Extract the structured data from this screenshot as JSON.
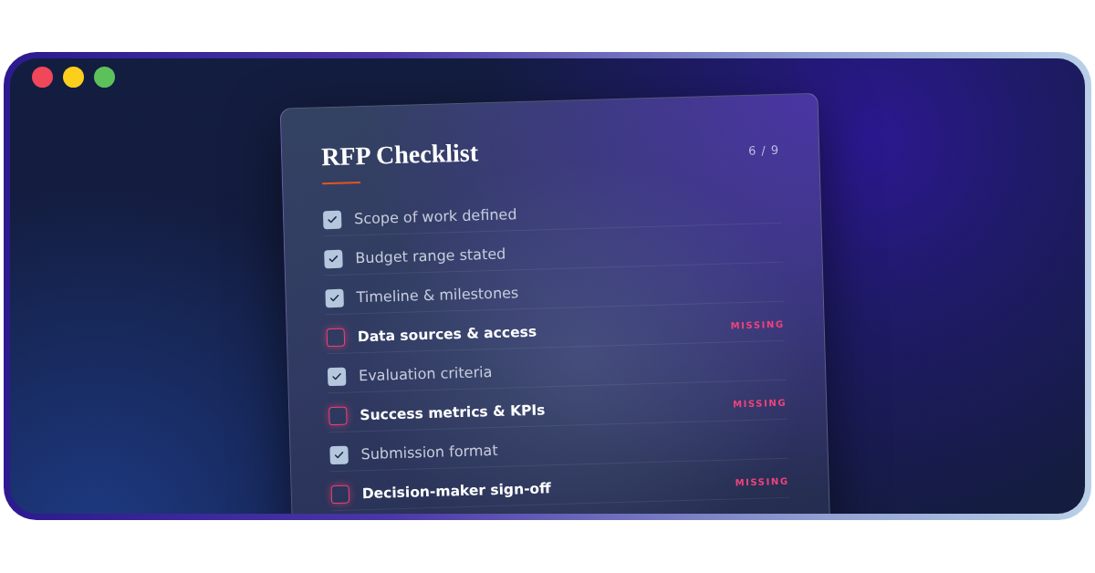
{
  "window": {
    "controls": [
      {
        "color": "#f0475b"
      },
      {
        "color": "#fbcf1c"
      },
      {
        "color": "#5dc15b"
      }
    ]
  },
  "checklist": {
    "title": "RFP Checklist",
    "count": "6 / 9",
    "items": [
      {
        "label": "Scope of work defined",
        "checked": true
      },
      {
        "label": "Budget range stated",
        "checked": true
      },
      {
        "label": "Timeline & milestones",
        "checked": true
      },
      {
        "label": "Data sources & access",
        "checked": false,
        "status": "MISSING"
      },
      {
        "label": "Evaluation criteria",
        "checked": true
      },
      {
        "label": "Success metrics & KPIs",
        "checked": false,
        "status": "MISSING"
      },
      {
        "label": "Submission format",
        "checked": true
      },
      {
        "label": "Decision-maker sign-off",
        "checked": false,
        "status": "MISSING"
      }
    ]
  }
}
